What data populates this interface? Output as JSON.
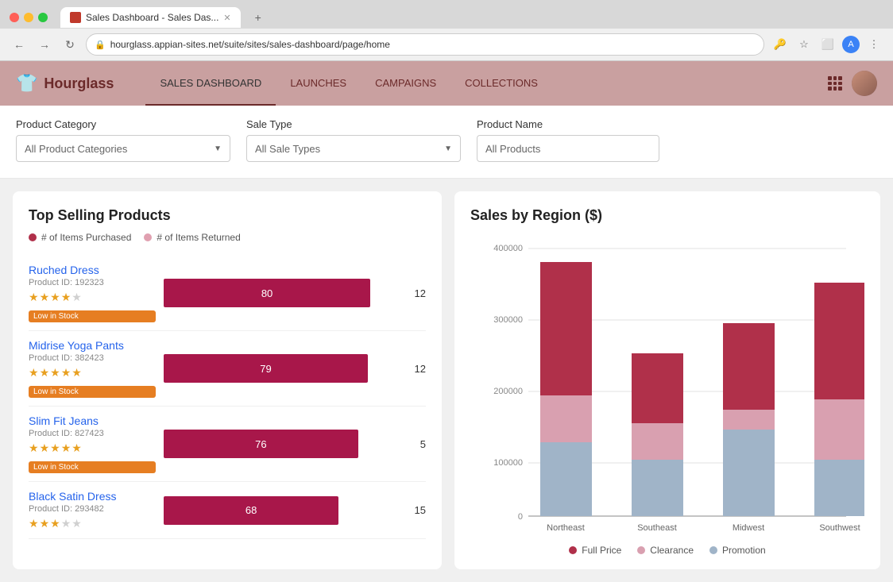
{
  "browser": {
    "tab_title": "Sales Dashboard - Sales Das...",
    "url": "hourglass.appian-sites.net/suite/sites/sales-dashboard/page/home",
    "new_tab_label": "+"
  },
  "app": {
    "logo": "Hourglass",
    "nav": [
      {
        "label": "SALES DASHBOARD",
        "active": true
      },
      {
        "label": "LAUNCHES",
        "active": false
      },
      {
        "label": "CAMPAIGNS",
        "active": false
      },
      {
        "label": "COLLECTIONS",
        "active": false
      }
    ]
  },
  "filters": {
    "product_category_label": "Product Category",
    "product_category_placeholder": "All Product Categories",
    "sale_type_label": "Sale Type",
    "sale_type_placeholder": "All Sale Types",
    "product_name_label": "Product Name",
    "product_name_placeholder": "All Products"
  },
  "top_selling": {
    "title": "Top Selling Products",
    "legend_purchased": "# of Items Purchased",
    "legend_returned": "# of Items Returned",
    "products": [
      {
        "name": "Ruched Dress",
        "id": "Product ID: 192323",
        "stars": 4,
        "low_stock": true,
        "purchased": 80,
        "returned": 12,
        "bar_width_pct": 80
      },
      {
        "name": "Midrise Yoga Pants",
        "id": "Product ID: 382423",
        "stars": 5,
        "low_stock": true,
        "purchased": 79,
        "returned": 12,
        "bar_width_pct": 79
      },
      {
        "name": "Slim Fit Jeans",
        "id": "Product ID: 827423",
        "stars": 5,
        "low_stock": true,
        "purchased": 76,
        "returned": 5,
        "bar_width_pct": 76
      },
      {
        "name": "Black Satin Dress",
        "id": "Product ID: 293482",
        "stars": 3,
        "low_stock": false,
        "purchased": 68,
        "returned": 15,
        "bar_width_pct": 68
      }
    ]
  },
  "sales_chart": {
    "title": "Sales by Region ($)",
    "y_labels": [
      "400000",
      "300000",
      "200000",
      "100000",
      "0"
    ],
    "regions": [
      "Northeast",
      "Southeast",
      "Midwest",
      "Southwest"
    ],
    "legend": {
      "full_price": "Full Price",
      "clearance": "Clearance",
      "promotion": "Promotion"
    },
    "colors": {
      "full_price": "#b0304a",
      "clearance": "#d9a0b0",
      "promotion": "#a0b4c8"
    },
    "data": [
      {
        "region": "Northeast",
        "full_price": 200000,
        "clearance": 70000,
        "promotion": 110000
      },
      {
        "region": "Southeast",
        "full_price": 105000,
        "clearance": 55000,
        "promotion": 85000
      },
      {
        "region": "Midwest",
        "full_price": 130000,
        "clearance": 30000,
        "promotion": 130000
      },
      {
        "region": "Southwest",
        "full_price": 175000,
        "clearance": 90000,
        "promotion": 85000
      }
    ]
  },
  "badges": {
    "low_in_stock": "Low in Stock"
  }
}
